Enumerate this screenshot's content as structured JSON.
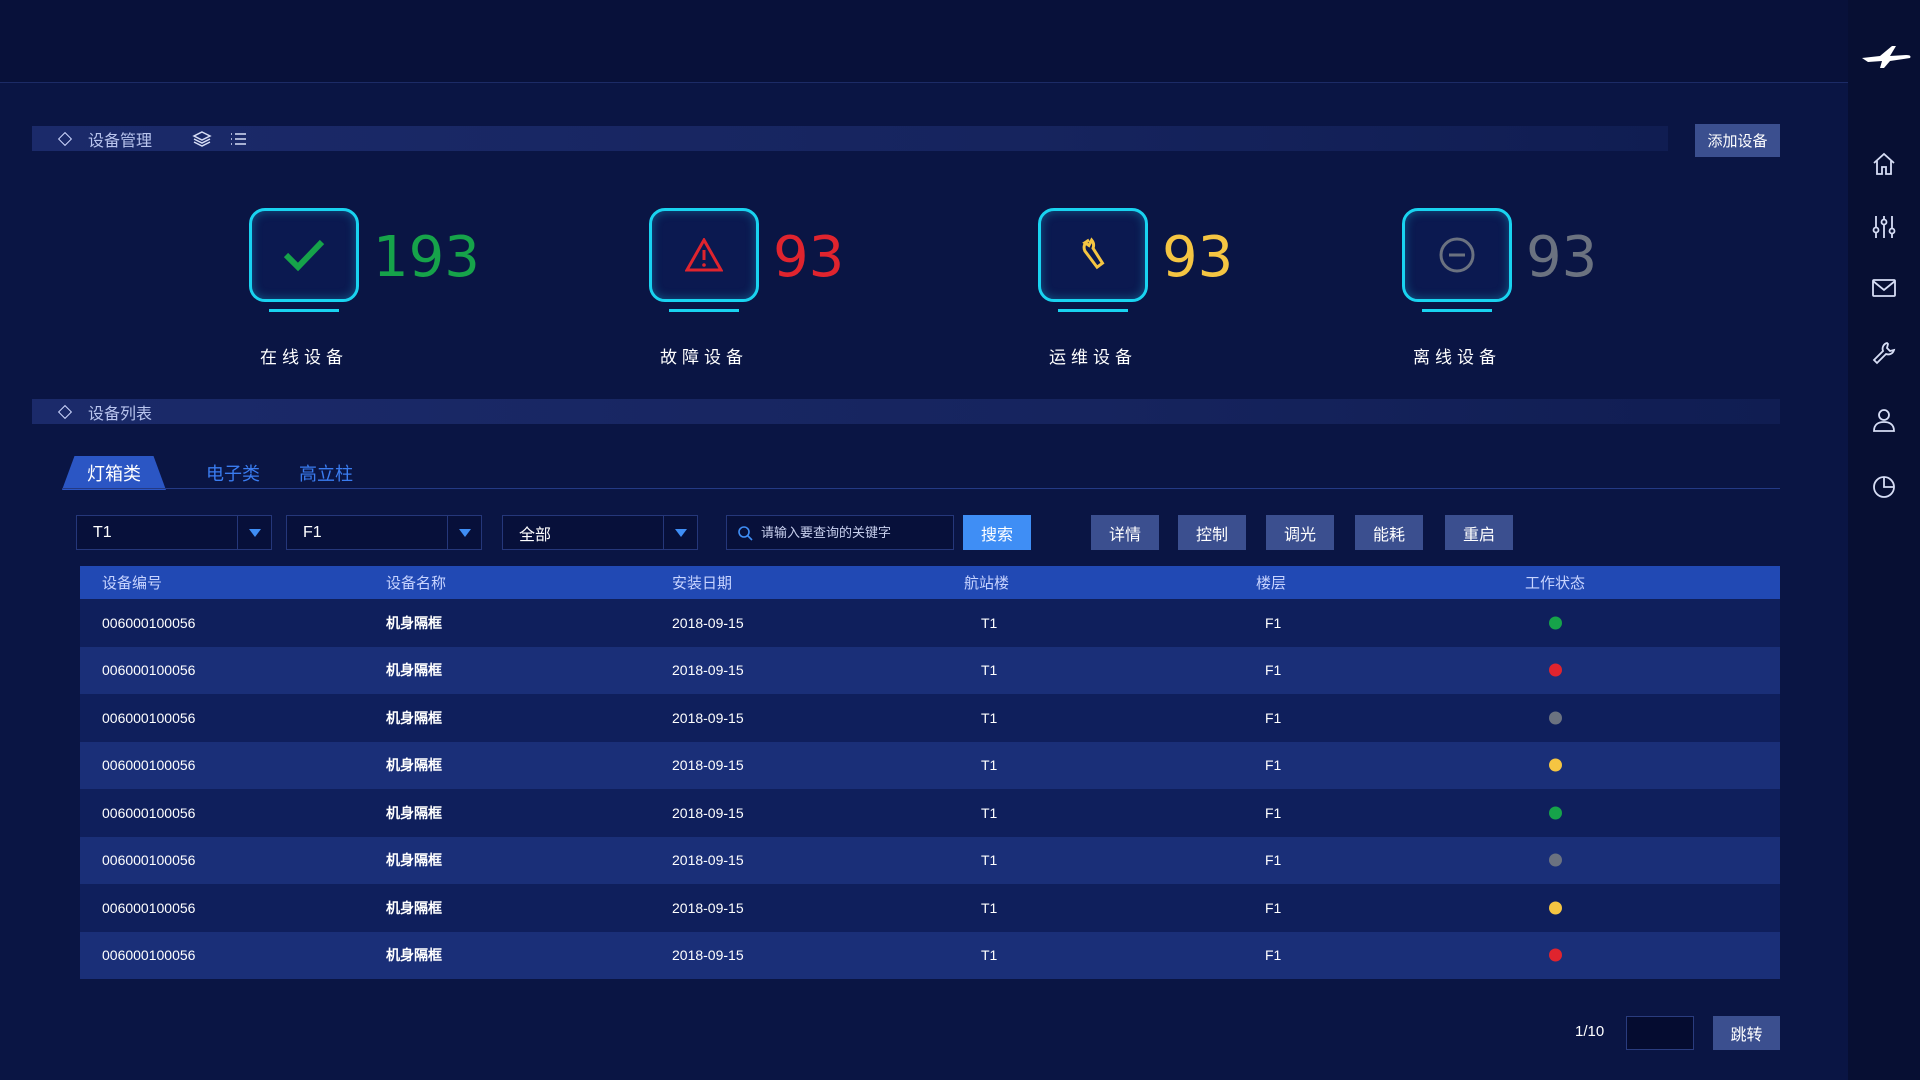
{
  "section_management": {
    "title": "设备管理",
    "add_button": "添加设备"
  },
  "stats": [
    {
      "value": "193",
      "label": "在线设备",
      "color": "#16a34a",
      "icon": "check-icon"
    },
    {
      "value": "93",
      "label": "故障设备",
      "color": "#e0242e",
      "icon": "warning-icon"
    },
    {
      "value": "93",
      "label": "运维设备",
      "color": "#f5c542",
      "icon": "wrench-icon"
    },
    {
      "value": "93",
      "label": "离线设备",
      "color": "#6b7280",
      "icon": "minus-circle-icon"
    }
  ],
  "section_list": {
    "title": "设备列表"
  },
  "tabs": [
    "灯箱类",
    "电子类",
    "高立柱"
  ],
  "filters": {
    "terminal": "T1",
    "floor": "F1",
    "status": "全部",
    "search_placeholder": "请输入要查询的关键字",
    "search_button": "搜索"
  },
  "actions": [
    "详情",
    "控制",
    "调光",
    "能耗",
    "重启"
  ],
  "table": {
    "headers": [
      "设备编号",
      "设备名称",
      "安装日期",
      "航站楼",
      "楼层",
      "工作状态"
    ],
    "rows": [
      {
        "id": "006000100056",
        "name": "机身隔框",
        "date": "2018-09-15",
        "terminal": "T1",
        "floor": "F1",
        "status": "online"
      },
      {
        "id": "006000100056",
        "name": "机身隔框",
        "date": "2018-09-15",
        "terminal": "T1",
        "floor": "F1",
        "status": "fault"
      },
      {
        "id": "006000100056",
        "name": "机身隔框",
        "date": "2018-09-15",
        "terminal": "T1",
        "floor": "F1",
        "status": "offline"
      },
      {
        "id": "006000100056",
        "name": "机身隔框",
        "date": "2018-09-15",
        "terminal": "T1",
        "floor": "F1",
        "status": "maintenance"
      },
      {
        "id": "006000100056",
        "name": "机身隔框",
        "date": "2018-09-15",
        "terminal": "T1",
        "floor": "F1",
        "status": "online"
      },
      {
        "id": "006000100056",
        "name": "机身隔框",
        "date": "2018-09-15",
        "terminal": "T1",
        "floor": "F1",
        "status": "offline"
      },
      {
        "id": "006000100056",
        "name": "机身隔框",
        "date": "2018-09-15",
        "terminal": "T1",
        "floor": "F1",
        "status": "maintenance"
      },
      {
        "id": "006000100056",
        "name": "机身隔框",
        "date": "2018-09-15",
        "terminal": "T1",
        "floor": "F1",
        "status": "fault"
      }
    ]
  },
  "status_colors": {
    "online": "#16a34a",
    "fault": "#e0242e",
    "offline": "#6b7280",
    "maintenance": "#f5c542"
  },
  "pagination": {
    "page_text": "1/10",
    "jump_button": "跳转"
  },
  "rail_icons": [
    "airplane-logo",
    "home-icon",
    "sliders-icon",
    "mail-icon",
    "wrench-icon",
    "user-icon",
    "pie-chart-icon"
  ]
}
